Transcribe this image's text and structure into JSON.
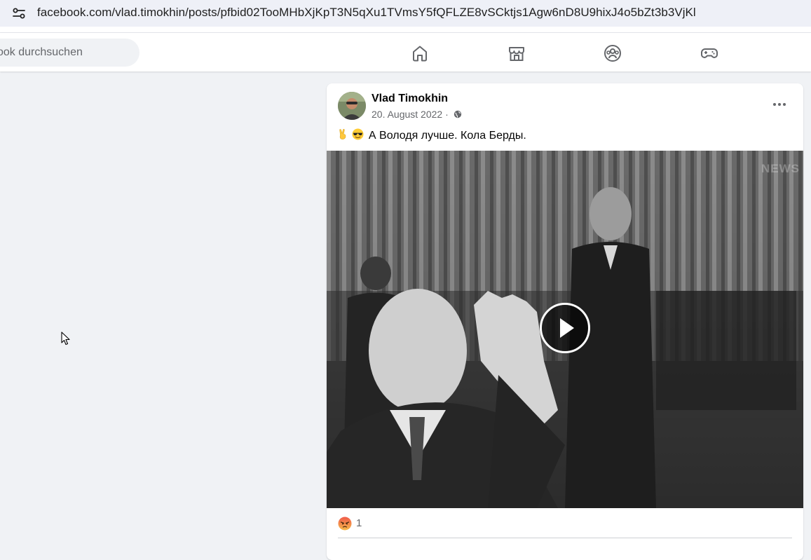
{
  "browser": {
    "url": "facebook.com/vlad.timokhin/posts/pfbid02TooMHbXjKpT3N5qXu1TVmsY5fQFLZE8vSCktjs1Agw6nD8U9hixJ4o5bZt3b3VjKl",
    "site_info_icon": "site-settings-icon"
  },
  "nav": {
    "search_placeholder": "ook durchsuchen",
    "icons": [
      "home-icon",
      "marketplace-icon",
      "groups-icon",
      "gaming-icon"
    ],
    "accent_color": "#65676b"
  },
  "post": {
    "author": "Vlad Timokhin",
    "date": "20. August 2022 ·",
    "privacy_icon": "globe-icon",
    "text": "А Володя лучше. Кола Берды.",
    "text_emojis": [
      "victory-hand-emoji",
      "sunglasses-face-emoji"
    ],
    "video": {
      "watermark": "NEWS",
      "play_icon": "play-icon"
    },
    "reactions": {
      "icon": "angry-reaction-icon",
      "count": "1",
      "color": "#e9710f"
    }
  }
}
